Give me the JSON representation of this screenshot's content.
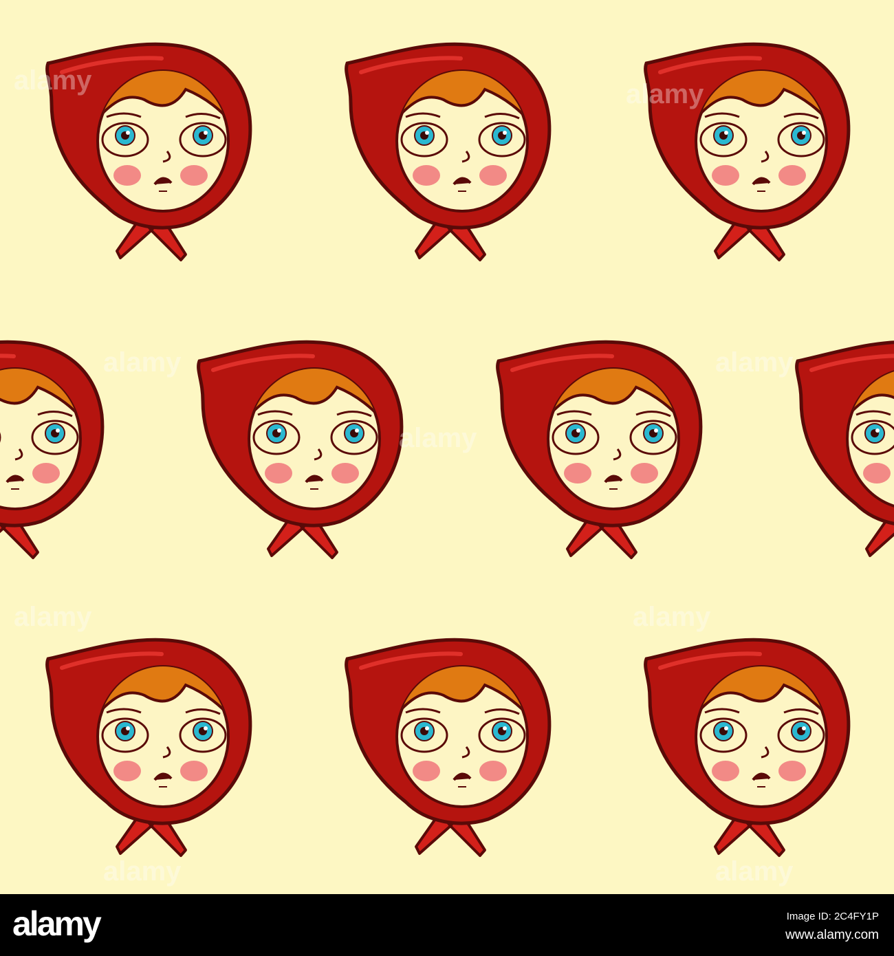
{
  "image": {
    "subject": "seamless pattern of girls wearing red headscarves",
    "colors": {
      "background": "#fdf7c3",
      "hood": "#b5140f",
      "outline": "#5a0a08",
      "hair": "#e07a12",
      "skin": "#fdf5c4",
      "iris": "#2ab8d0",
      "cheek": "#f28a86"
    },
    "watermark": "alamy"
  },
  "footer": {
    "logo": "alamy",
    "image_id": "Image ID: 2C4FY1P",
    "url": "www.alamy.com"
  }
}
